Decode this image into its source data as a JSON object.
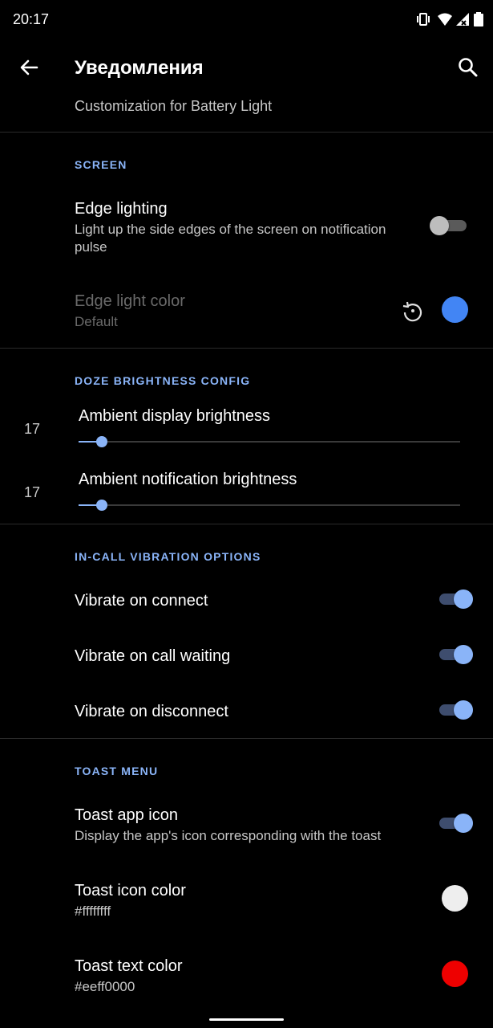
{
  "status_bar": {
    "time": "20:17"
  },
  "toolbar": {
    "title": "Уведомления",
    "subtitle": "Customization for Battery Light"
  },
  "screen": {
    "header": "SCREEN",
    "edge_lighting": {
      "title": "Edge lighting",
      "summary": "Light up the side edges of the screen on notification pulse",
      "enabled": false
    },
    "edge_light_color": {
      "title": "Edge light color",
      "summary": "Default",
      "color": "#4285f4"
    }
  },
  "doze": {
    "header": "DOZE BRIGHTNESS CONFIG",
    "ambient_display": {
      "value": "17",
      "label": "Ambient display brightness",
      "fraction": 0.06
    },
    "ambient_notification": {
      "value": "17",
      "label": "Ambient notification brightness",
      "fraction": 0.06
    }
  },
  "vibration": {
    "header": "IN-CALL VIBRATION OPTIONS",
    "items": [
      {
        "title": "Vibrate on connect",
        "enabled": true
      },
      {
        "title": "Vibrate on call waiting",
        "enabled": true
      },
      {
        "title": "Vibrate on disconnect",
        "enabled": true
      }
    ]
  },
  "toast": {
    "header": "TOAST MENU",
    "app_icon": {
      "title": "Toast app icon",
      "summary": "Display the app's icon corresponding with the toast",
      "enabled": true
    },
    "icon_color": {
      "title": "Toast icon color",
      "summary": "#ffffffff",
      "color": "#eeeeee"
    },
    "text_color": {
      "title": "Toast text color",
      "summary": "#eeff0000",
      "color": "#ee0000"
    }
  },
  "colors": {
    "accent": "#8ab4f8",
    "background": "#000000"
  }
}
